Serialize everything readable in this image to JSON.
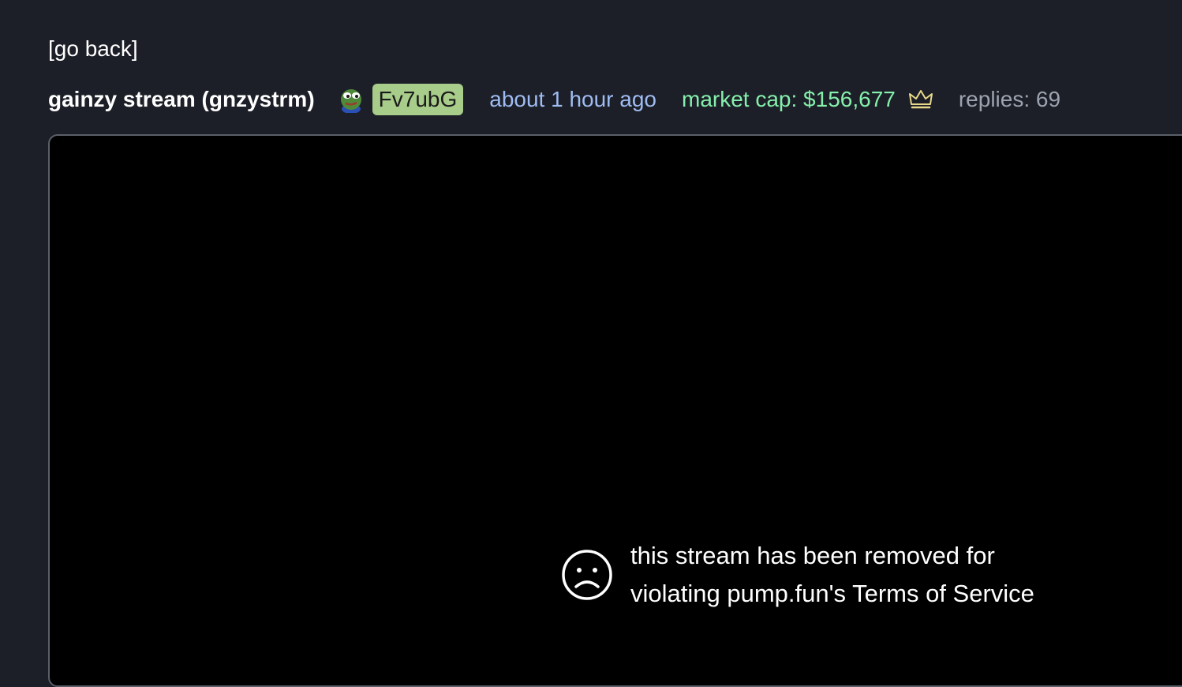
{
  "nav": {
    "back_label": "[go back]"
  },
  "coin": {
    "title": "gainzy stream (gnzystrm)",
    "creator_avatar_icon": "pepe-frog-icon",
    "creator": "Fv7ubG",
    "created": "about 1 hour ago",
    "market_cap": "market cap: $156,677",
    "crown_icon": "crown-icon",
    "replies": "replies: 69"
  },
  "stream": {
    "status_icon": "sad-face-icon",
    "notice_line1": "this stream has been removed for",
    "notice_line2": "violating pump.fun's Terms of Service"
  },
  "colors": {
    "background": "#1c1f27",
    "creator_badge": "#a8cc8a",
    "time": "#9fbcf2",
    "market_cap": "#86efac",
    "replies": "#9ca3af",
    "crown": "#e8d98a"
  }
}
